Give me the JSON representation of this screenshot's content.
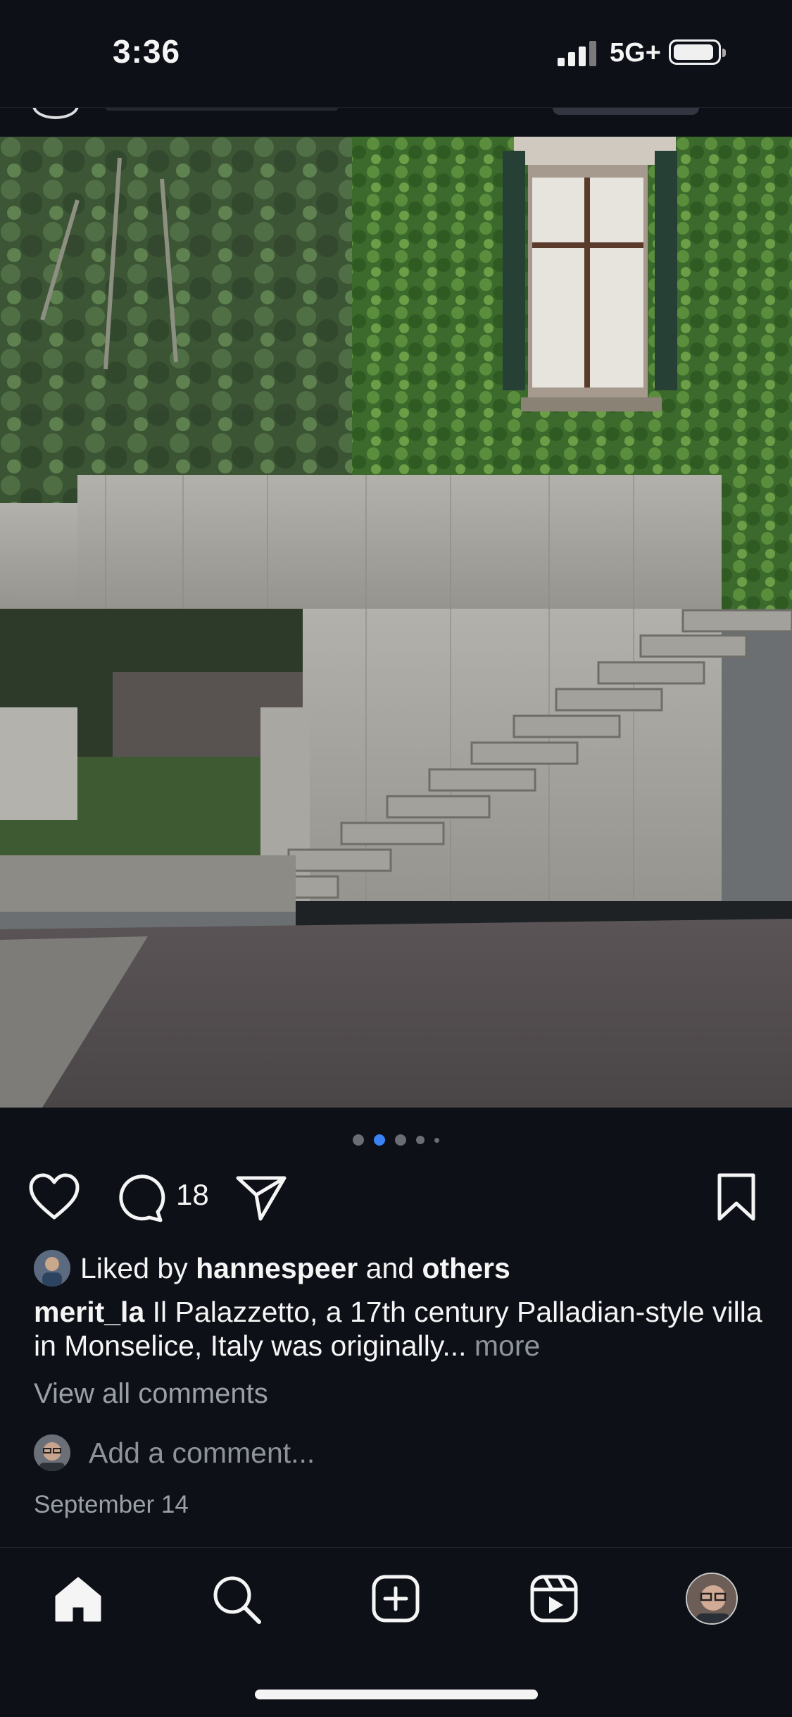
{
  "status_bar": {
    "time": "3:36",
    "network": "5G+"
  },
  "post": {
    "carousel": {
      "total": 5,
      "active_index": 1
    },
    "comment_count": "18",
    "likes": {
      "prefix": "Liked by ",
      "user": "hannespeer",
      "middle": " and ",
      "suffix": "others"
    },
    "caption": {
      "username": "merit_la",
      "text": " Il Palazzetto, a 17th century Palladian-style villa in Monselice, Italy was originally",
      "ellipsis": "...",
      "more": " more"
    },
    "view_all_comments": "View all comments",
    "add_comment_placeholder": "Add a comment...",
    "date": "September 14"
  },
  "tab_bar": {
    "items": [
      "home-icon",
      "search-icon",
      "create-icon",
      "reels-icon",
      "profile-avatar"
    ]
  },
  "colors": {
    "background": "#0d1017",
    "accent_dot": "#3b82f6",
    "muted_text": "#9aa0a6"
  }
}
